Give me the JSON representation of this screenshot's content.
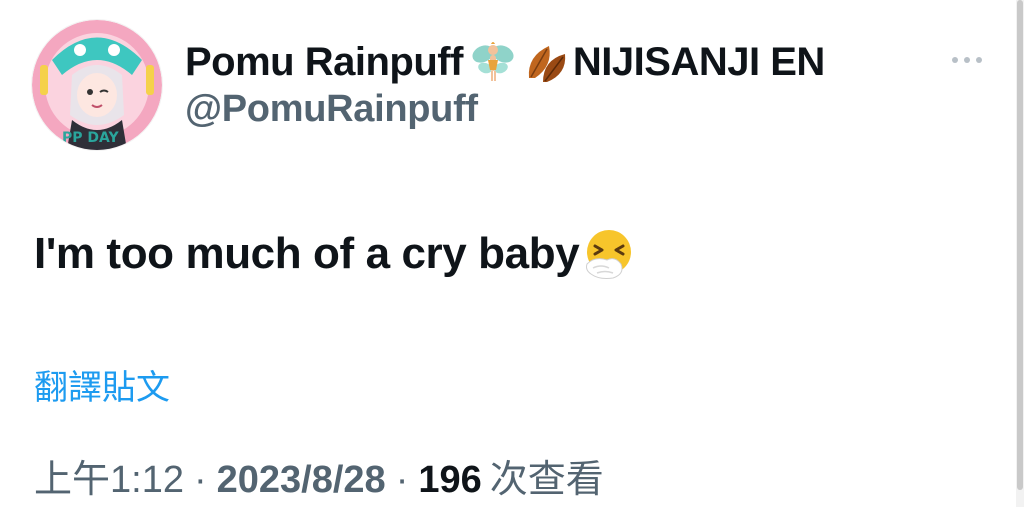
{
  "author": {
    "display_name": "Pomu Rainpuff",
    "org_name": "NIJISANJI EN",
    "handle": "@PomuRainpuff",
    "name_emojis": [
      "fairy-icon",
      "fallen-leaf-icon"
    ]
  },
  "tweet": {
    "text": "I'm too much of a cry baby",
    "trailing_emoji": "sneezing-face-icon"
  },
  "translate_label": "翻譯貼文",
  "meta": {
    "time": "上午1:12",
    "separator": "·",
    "date": "2023/8/28",
    "view_count": "196",
    "views_label": "次查看"
  },
  "colors": {
    "text_primary": "#0f1419",
    "text_secondary": "#536471",
    "link": "#1d9bf0"
  }
}
